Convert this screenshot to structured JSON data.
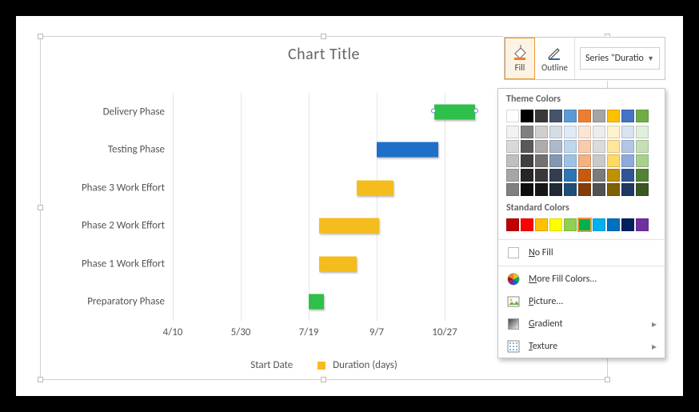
{
  "chart_data": {
    "type": "bar",
    "orientation": "horizontal",
    "title": "Chart Title",
    "categories": [
      "Delivery Phase",
      "Testing Phase",
      "Phase 3 Work Effort",
      "Phase 2 Work Effort",
      "Phase 1 Work Effort",
      "Preparatory Phase"
    ],
    "x_ticks": [
      "4/10",
      "5/30",
      "7/19",
      "9/7",
      "10/27"
    ],
    "series": [
      {
        "name": "Duration (days)",
        "color": "#f5bc1e"
      },
      {
        "name": "Start Date"
      }
    ],
    "bars": [
      {
        "cat": "Delivery Phase",
        "start_tick": 3.85,
        "width_ticks": 0.6,
        "series": "Duration (days)",
        "color": "#2fbf4b",
        "selected": true
      },
      {
        "cat": "Testing Phase",
        "start_tick": 3.0,
        "width_ticks": 0.9,
        "series": "Duration (days)",
        "color": "#1f6fc9"
      },
      {
        "cat": "Phase 3 Work Effort",
        "start_tick": 2.7,
        "width_ticks": 0.55,
        "series": "Duration (days)",
        "color": "#f5bc1e"
      },
      {
        "cat": "Phase 2 Work Effort",
        "start_tick": 2.15,
        "width_ticks": 0.88,
        "series": "Duration (days)",
        "color": "#f5bc1e"
      },
      {
        "cat": "Phase 1 Work Effort",
        "start_tick": 2.15,
        "width_ticks": 0.55,
        "series": "Duration (days)",
        "color": "#f5bc1e"
      },
      {
        "cat": "Preparatory Phase",
        "start_tick": 2.0,
        "width_ticks": 0.22,
        "series": "Duration (days)",
        "color": "#2fbf4b"
      }
    ],
    "xlim_ticks": [
      0,
      5
    ]
  },
  "toolbar": {
    "fill_label": "Fill",
    "outline_label": "Outline",
    "selector_text": "Series \"Duratio"
  },
  "dropdown": {
    "theme_heading": "Theme Colors",
    "theme_row1": [
      "#ffffff",
      "#000000",
      "#3b3838",
      "#44546a",
      "#5b9bd5",
      "#ed7d31",
      "#a5a5a5",
      "#ffc000",
      "#4472c4",
      "#70ad47"
    ],
    "theme_tints": [
      [
        "#f2f2f2",
        "#808080",
        "#d0cece",
        "#d6dce4",
        "#deebf7",
        "#fbe5d6",
        "#ededed",
        "#fff2cc",
        "#d9e2f3",
        "#e2efda"
      ],
      [
        "#d9d9d9",
        "#595959",
        "#aeabab",
        "#adb9ca",
        "#bdd7ee",
        "#f8cbad",
        "#dbdbdb",
        "#ffe699",
        "#b4c6e7",
        "#c5e0b4"
      ],
      [
        "#bfbfbf",
        "#404040",
        "#757070",
        "#8497b0",
        "#9cc3e6",
        "#f4b183",
        "#c9c9c9",
        "#ffd965",
        "#8eaadb",
        "#a9d18e"
      ],
      [
        "#a6a6a6",
        "#262626",
        "#3a3838",
        "#333f50",
        "#2e75b6",
        "#c55a11",
        "#7b7b7b",
        "#bf9000",
        "#2f5597",
        "#548235"
      ],
      [
        "#808080",
        "#0d0d0d",
        "#171616",
        "#222a35",
        "#1f4e79",
        "#843c0c",
        "#525252",
        "#806000",
        "#1f3864",
        "#385723"
      ]
    ],
    "standard_heading": "Standard Colors",
    "standard_colors": [
      "#c00000",
      "#ff0000",
      "#ffc000",
      "#ffff00",
      "#92d050",
      "#00b050",
      "#00b0f0",
      "#0070c0",
      "#002060",
      "#7030a0"
    ],
    "standard_selected_index": 5,
    "nofill": "No Fill",
    "more": "More Fill Colors...",
    "picture": "Picture...",
    "gradient": "Gradient",
    "texture": "Texture"
  }
}
